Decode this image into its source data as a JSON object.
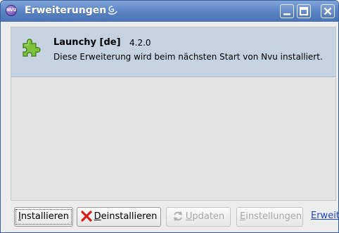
{
  "window": {
    "title": "Erweiterungen",
    "app_icon_text": "NVU"
  },
  "extension": {
    "name": "Launchy [de]",
    "version": "4.2.0",
    "status": "Diese Erweiterung wird beim nächsten Start von Nvu installiert."
  },
  "buttons": {
    "install_prefix": "I",
    "install_rest": "nstallieren",
    "uninstall_prefix": "D",
    "uninstall_rest": "einstallieren",
    "update_prefix": "U",
    "update_rest": "pdaten",
    "settings_prefix": "E",
    "settings_rest": "instellungen"
  },
  "link": {
    "text": "Erweit"
  },
  "colors": {
    "titlebar": "#5b84c4",
    "selection": "#c5d2e0",
    "link": "#1f43c9"
  }
}
